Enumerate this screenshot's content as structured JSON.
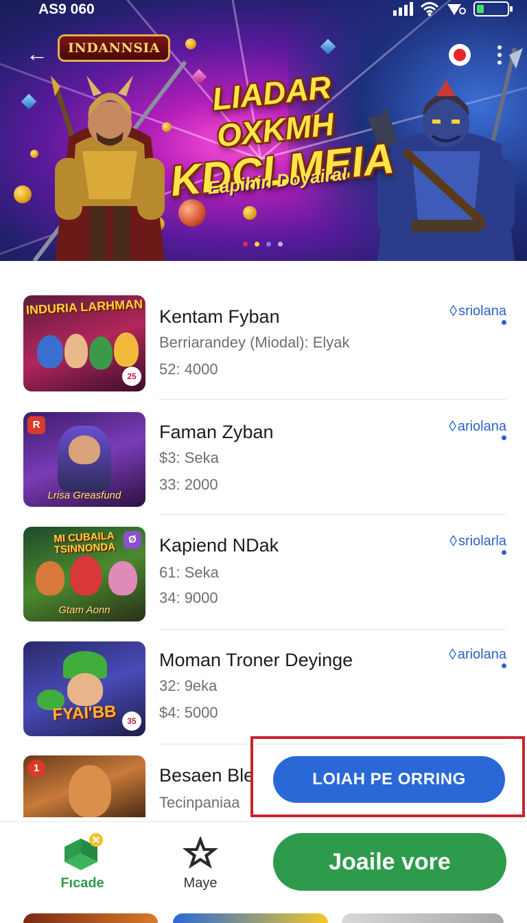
{
  "status_bar": {
    "time": "AS9 060"
  },
  "header": {
    "logo_text": "INDANNSIA"
  },
  "banner": {
    "title_line1": "LIADAR OXKMH",
    "title_line2": "KDCLMEIA",
    "subtitle": "Eapihin Doyaira!",
    "dot_colors": [
      "#e8264a",
      "#ffd23a",
      "#8c7bd9",
      "#b9b4d8",
      "#b9b4d8"
    ]
  },
  "items": [
    {
      "title": "Kentam Fyban",
      "subtitle": "Berriarandey (Miodal): Elyak",
      "price": "52: 4000",
      "tag": "sriolana",
      "thumb_title": "INDURIA LARHMAN",
      "thumb_badge": "25"
    },
    {
      "title": "Faman Zyban",
      "subtitle": "$3: Seka",
      "price": "33: 2000",
      "tag": "ariolana",
      "thumb_caption": "Lrisa Greasfund",
      "thumb_corner": "R"
    },
    {
      "title": "Kapiend NDak",
      "subtitle": "61: Seka",
      "price": "34: 9000",
      "tag": "sriolarla",
      "thumb_title": "MI CUBAILA TSINNONDA",
      "thumb_caption": "Gtam Aonn",
      "thumb_corner": "Ø"
    },
    {
      "title": "Moman Troner Deyinge",
      "subtitle": "32: 9eka",
      "price": "$4: 5000",
      "tag": "ariolana",
      "thumb_title": "FYAI'BB",
      "thumb_badge": "35"
    },
    {
      "title": "Besaen Ble",
      "subtitle": "Tecinpaniaa",
      "thumb_corner": "1"
    }
  ],
  "overlay_button": {
    "label": "LOIAH PE ORRING"
  },
  "bottom_nav": {
    "items": [
      {
        "label": "Fıcade",
        "icon": "gift-box-icon",
        "color": "#2e9b4c"
      },
      {
        "label": "Maye",
        "icon": "star-icon",
        "color": "#333333"
      }
    ],
    "join_label": "Joaile vore"
  },
  "colors": {
    "accent_blue": "#2a68d8",
    "accent_green": "#2e9b4c",
    "highlight_red": "#c7242b",
    "link_blue": "#2b63c6"
  }
}
